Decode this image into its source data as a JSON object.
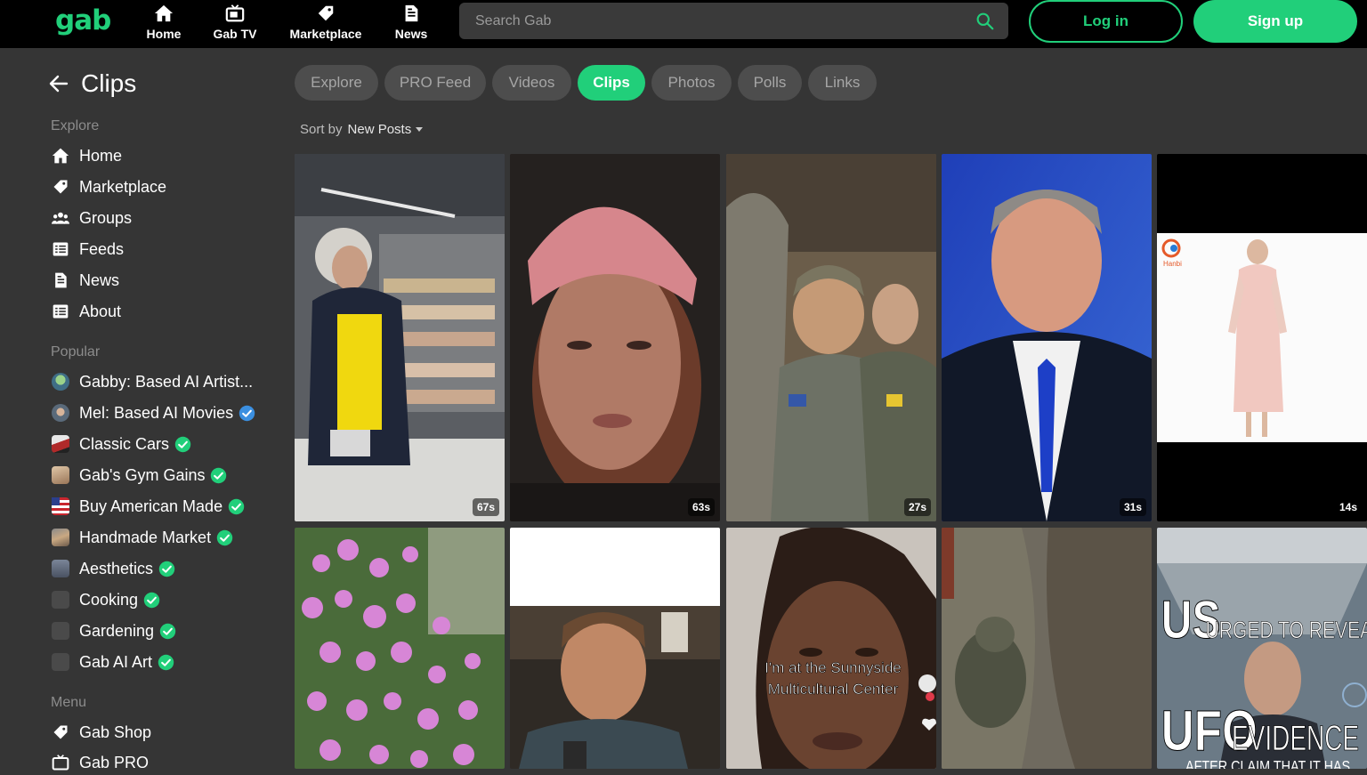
{
  "brand": {
    "logo_text": "gab",
    "accent": "#21cf7a"
  },
  "topnav": [
    {
      "label": "Home",
      "icon": "home-icon"
    },
    {
      "label": "Gab TV",
      "icon": "tv-icon"
    },
    {
      "label": "Marketplace",
      "icon": "tag-icon"
    },
    {
      "label": "News",
      "icon": "news-icon"
    }
  ],
  "search": {
    "placeholder": "Search Gab"
  },
  "auth": {
    "login": "Log in",
    "signup": "Sign up"
  },
  "page": {
    "title": "Clips"
  },
  "sidebar": {
    "explore_heading": "Explore",
    "explore": [
      {
        "label": "Home",
        "icon": "home-icon"
      },
      {
        "label": "Marketplace",
        "icon": "tag-icon"
      },
      {
        "label": "Groups",
        "icon": "groups-icon"
      },
      {
        "label": "Feeds",
        "icon": "list-icon"
      },
      {
        "label": "News",
        "icon": "news-icon"
      },
      {
        "label": "About",
        "icon": "list-icon"
      }
    ],
    "popular_heading": "Popular",
    "popular": [
      {
        "label": "Gabby: Based AI Artist...",
        "badge": "none"
      },
      {
        "label": "Mel: Based AI Movies",
        "badge": "blue"
      },
      {
        "label": "Classic Cars",
        "badge": "green"
      },
      {
        "label": "Gab's Gym Gains",
        "badge": "green"
      },
      {
        "label": "Buy American Made",
        "badge": "green"
      },
      {
        "label": "Handmade Market",
        "badge": "green"
      },
      {
        "label": "Aesthetics",
        "badge": "green"
      },
      {
        "label": "Cooking",
        "badge": "green"
      },
      {
        "label": "Gardening",
        "badge": "green"
      },
      {
        "label": "Gab AI Art",
        "badge": "green"
      }
    ],
    "menu_heading": "Menu",
    "menu": [
      {
        "label": "Gab Shop",
        "icon": "tag-icon"
      },
      {
        "label": "Gab PRO",
        "icon": "tv-icon"
      }
    ]
  },
  "tabs": [
    {
      "label": "Explore",
      "active": false
    },
    {
      "label": "PRO Feed",
      "active": false
    },
    {
      "label": "Videos",
      "active": false
    },
    {
      "label": "Clips",
      "active": true
    },
    {
      "label": "Photos",
      "active": false
    },
    {
      "label": "Polls",
      "active": false
    },
    {
      "label": "Links",
      "active": false
    }
  ],
  "sort": {
    "label": "Sort by",
    "value": "New Posts"
  },
  "clips": [
    {
      "duration": "67s",
      "scene": "man-in-grocery-store"
    },
    {
      "duration": "63s",
      "scene": "woman-pink-beanie"
    },
    {
      "duration": "27s",
      "scene": "soldiers-in-vehicle"
    },
    {
      "duration": "31s",
      "scene": "tv-presenter-blue-tie"
    },
    {
      "duration": "14s",
      "scene": "dress-product-ad"
    },
    {
      "duration": "",
      "scene": "pink-flowers"
    },
    {
      "duration": "",
      "scene": "man-interview"
    },
    {
      "duration": "",
      "scene": "woman-selfie",
      "caption_line1": "I'm at the Sunnyside",
      "caption_line2": "Multicultural Center"
    },
    {
      "duration": "",
      "scene": "soldier-trench"
    },
    {
      "duration": "",
      "scene": "ufo-news",
      "caption_line1": "US",
      "caption_line2": "URGED TO REVEAL",
      "caption_line3": "UFO",
      "caption_line4": "EVIDENCE",
      "caption_line5": "AFTER CLAIM THAT IT HAS"
    }
  ],
  "thumb_overlays": {
    "hanbi_logo": "Hanbi"
  }
}
